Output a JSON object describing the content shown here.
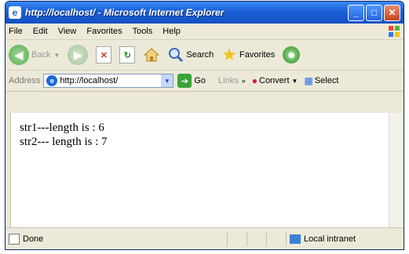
{
  "titlebar": {
    "title": "http://localhost/ - Microsoft Internet Explorer"
  },
  "menu": [
    "File",
    "Edit",
    "View",
    "Favorites",
    "Tools",
    "Help"
  ],
  "toolbar": {
    "back": "Back",
    "search": "Search",
    "favorites": "Favorites"
  },
  "address": {
    "label": "Address",
    "url": "http://localhost/",
    "go": "Go",
    "links": "Links",
    "convert": "Convert",
    "select": "Select"
  },
  "content": {
    "line1": "str1---length is : 6",
    "line2": "str2--- length is : 7"
  },
  "status": {
    "text": "Done",
    "zone": "Local intranet"
  }
}
